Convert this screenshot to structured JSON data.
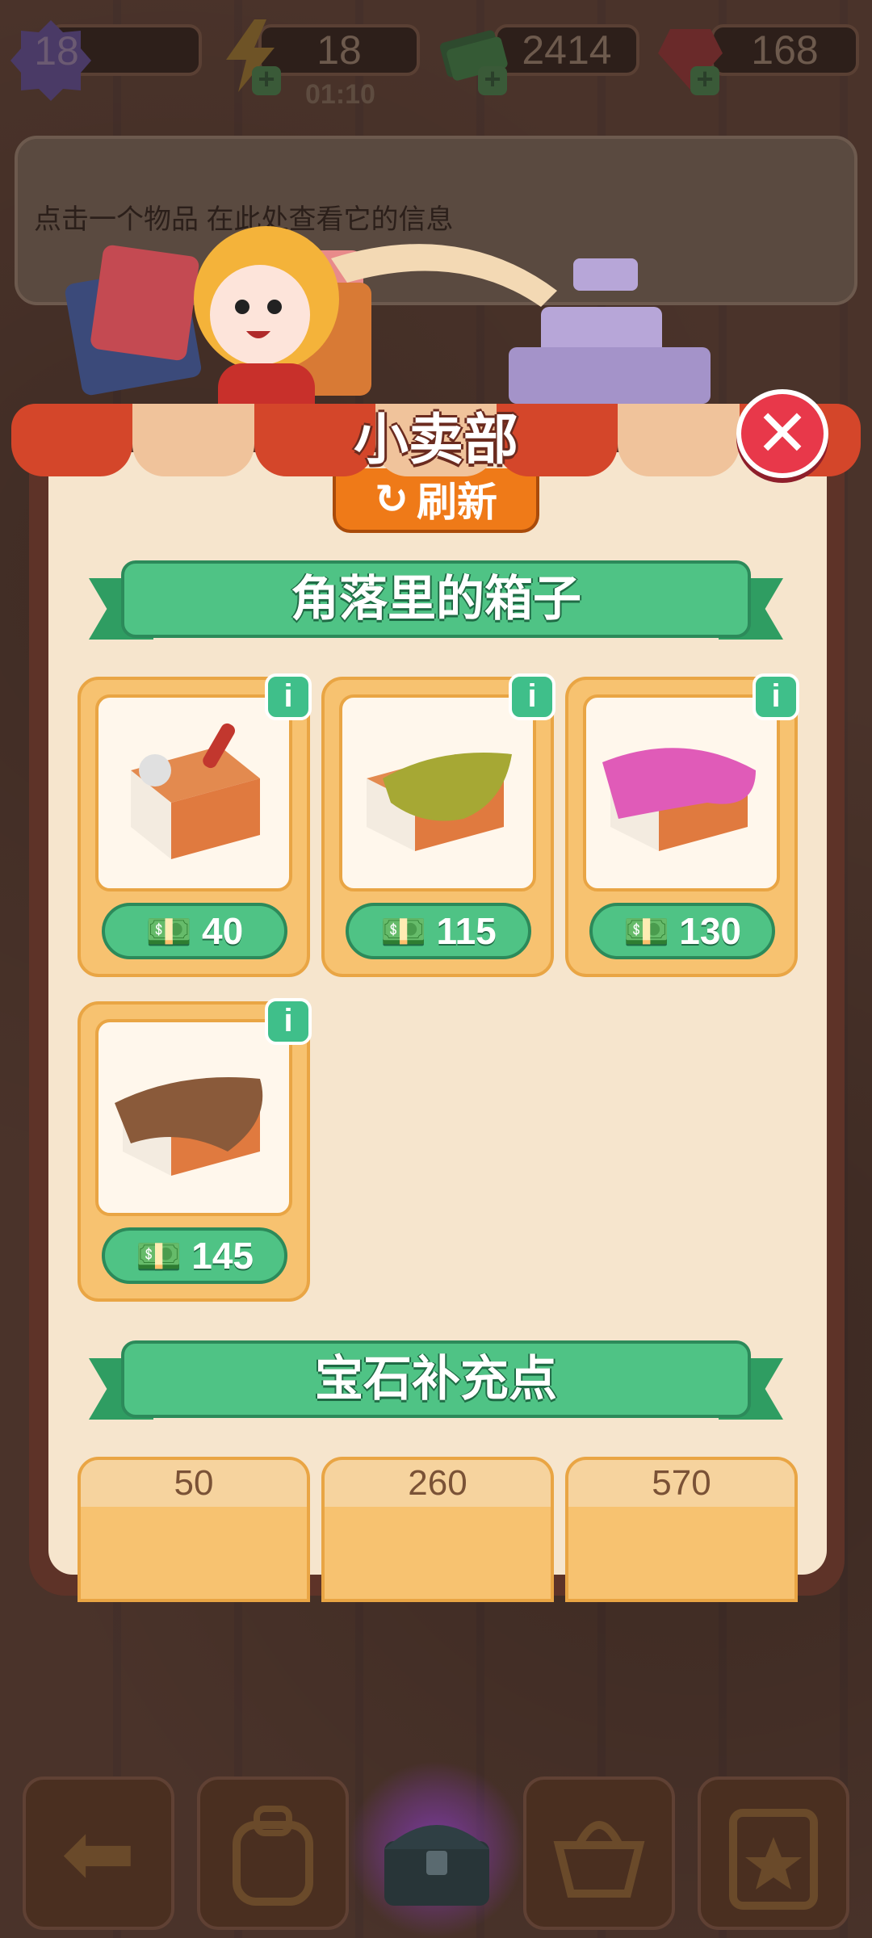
{
  "hud": {
    "level": "18",
    "energy": "18",
    "energy_timer": "01:10",
    "cash": "2414",
    "gems": "168"
  },
  "info_panel": {
    "hint": "点击一个物品 在此处查看它的信息"
  },
  "shop": {
    "title": "小卖部",
    "refresh_label": "刷新",
    "section_boxes": "角落里的箱子",
    "section_gems": "宝石补充点",
    "items": [
      {
        "price": "40",
        "icon": "toolbox-icon"
      },
      {
        "price": "115",
        "icon": "green-cloth-box-icon"
      },
      {
        "price": "130",
        "icon": "pink-cloth-box-icon"
      },
      {
        "price": "145",
        "icon": "brown-cloth-box-icon"
      }
    ],
    "gem_packs": [
      {
        "amount": "50"
      },
      {
        "amount": "260"
      },
      {
        "amount": "570"
      }
    ]
  },
  "colors": {
    "accent_green": "#4fc385",
    "awning_red": "#d4462a",
    "close_red": "#e8384a",
    "refresh_orange": "#ef7a18"
  }
}
